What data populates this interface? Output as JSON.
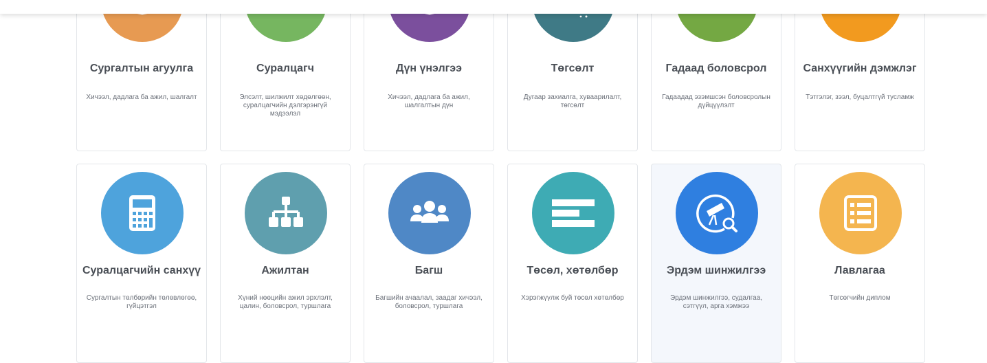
{
  "cards": [
    {
      "title": "Сургалтын агуулга",
      "desc": "Хичээл, дадлага ба ажил, шалгалт",
      "color": "#e79a52",
      "icon": "book-icon"
    },
    {
      "title": "Суралцагч",
      "desc": "Элсэлт, шилжилт хөдөлгөөн, суралцагчийн дэлгэрэнгүй мэдээлэл",
      "color": "#76b660",
      "icon": "student-icon"
    },
    {
      "title": "Дүн үнэлгээ",
      "desc": "Хичээл, дадлага ба ажил, шалгалтын дүн",
      "color": "#7b4f9d",
      "icon": "grade-book-icon"
    },
    {
      "title": "Төгсөлт",
      "desc": "Дугаар захиалга, хуваарилалт, төгсөлт",
      "color": "#3f7a86",
      "icon": "graduation-cap-icon"
    },
    {
      "title": "Гадаад боловсрол",
      "desc": "Гадаадад эзэмшсэн боловсролын дүйцүүлэлт",
      "color": "#74a843",
      "icon": "globe-icon"
    },
    {
      "title": "Санхүүгийн дэмжлэг",
      "desc": "Тэтгэлэг, зээл, буцалтгүй тусламж",
      "color": "#f29a1f",
      "icon": "check-icon"
    },
    {
      "title": "Суралцагчийн санхүү",
      "desc": "Сургалтын төлбөрийн төлөвлөгөө, гүйцэтгэл",
      "color": "#4ea3dc",
      "icon": "calculator-icon"
    },
    {
      "title": "Ажилтан",
      "desc": "Хүний нөөцийн ажил эрхлэлт, цалин, боловсрол, туршлага",
      "color": "#5f9fae",
      "icon": "org-chart-icon"
    },
    {
      "title": "Багш",
      "desc": "Багшийн ачаалал, заадаг хичээл, боловсрол, туршлага",
      "color": "#4f88c6",
      "icon": "users-icon"
    },
    {
      "title": "Төсөл, хөтөлбөр",
      "desc": "Хэрэгжүүлж буй төсөл хөтөлбөр",
      "color": "#3eabb4",
      "icon": "list-bars-icon"
    },
    {
      "title": "Эрдэм шинжилгээ",
      "desc": "Эрдэм шинжилгээ, судалгаа, сэтгүүл, арга хэмжээ",
      "color": "#2f7fe0",
      "icon": "telescope-search-icon"
    },
    {
      "title": "Лавлагаа",
      "desc": "Төгсөгчийн диплом",
      "color": "#f4b54f",
      "icon": "reference-list-icon"
    }
  ]
}
